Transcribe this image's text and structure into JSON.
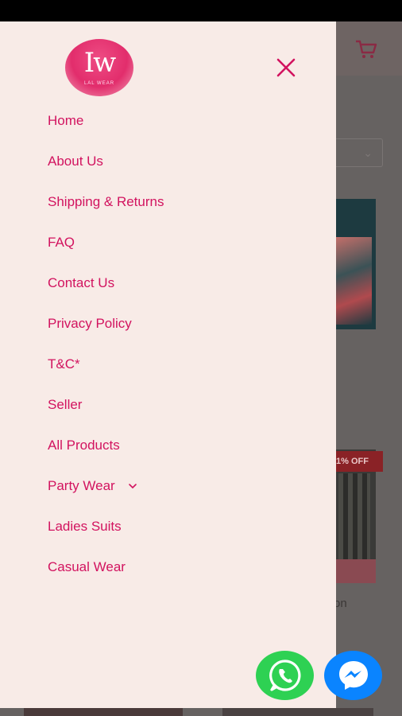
{
  "drawer": {
    "logo": {
      "text": "Iw",
      "sub": "LAL WEAR"
    },
    "menu": [
      {
        "label": "Home"
      },
      {
        "label": "About Us"
      },
      {
        "label": "Shipping & Returns"
      },
      {
        "label": "FAQ"
      },
      {
        "label": "Contact Us"
      },
      {
        "label": "Privacy Policy"
      },
      {
        "label": "T&C*"
      },
      {
        "label": "Seller"
      },
      {
        "label": "All Products"
      },
      {
        "label": "Party Wear",
        "has_submenu": true
      },
      {
        "label": "Ladies Suits"
      },
      {
        "label": "Casual Wear"
      }
    ]
  },
  "background": {
    "badge_text": "1% OFF",
    "product_text": "on"
  },
  "icons": {
    "close": "close-icon",
    "cart": "cart-icon",
    "whatsapp": "whatsapp-icon",
    "messenger": "messenger-icon",
    "chevron": "chevron-down-icon"
  },
  "colors": {
    "accent": "#d2135f",
    "drawer_bg": "#f8ebe7",
    "whatsapp": "#2ed153",
    "messenger": "#0a84ff"
  }
}
